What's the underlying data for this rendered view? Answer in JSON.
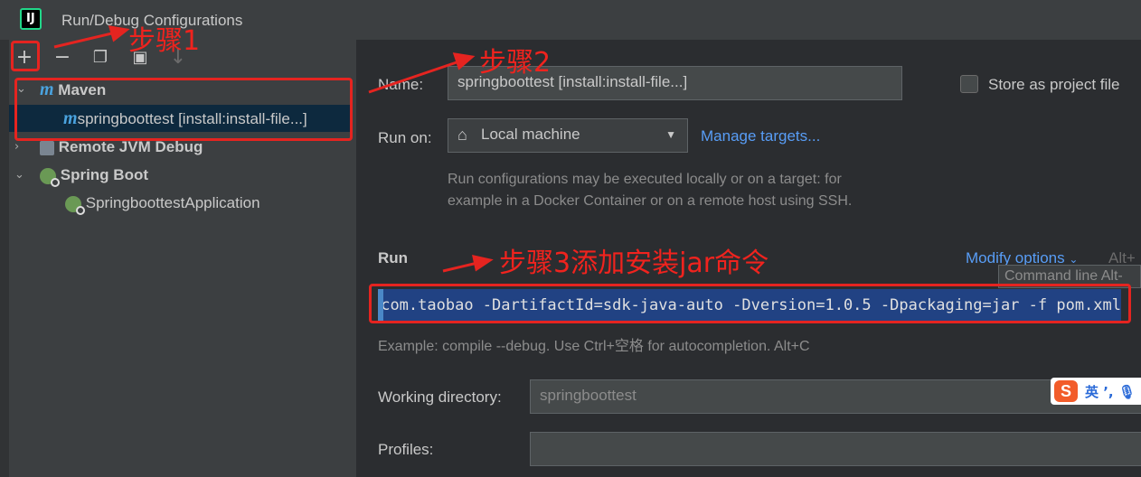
{
  "window": {
    "title": "Run/Debug Configurations",
    "app_icon_letter": "IJ"
  },
  "toolbar": {
    "add": "+",
    "remove": "−",
    "copy": "❐",
    "folder": "▣",
    "sort": "↓"
  },
  "tree": [
    {
      "label": "Maven",
      "expanded": true
    },
    {
      "label": "springboottest [install:install-file...]",
      "selected": true
    },
    {
      "label": "Remote JVM Debug",
      "expanded": false
    },
    {
      "label": "Spring Boot",
      "expanded": true
    },
    {
      "label": "SpringboottestApplication"
    }
  ],
  "form": {
    "name_label": "Name:",
    "name_value": "springboottest [install:install-file...]",
    "store_label": "Store as project file",
    "run_on_label": "Run on:",
    "run_on_value": "Local machine",
    "manage_targets": "Manage targets...",
    "run_on_hint_1": "Run configurations may be executed locally or on a target: for",
    "run_on_hint_2": "example in a Docker Container or on a remote host using SSH.",
    "run_section": "Run",
    "modify_options": "Modify options",
    "modify_shortcut": "Alt+",
    "tooltip": "Command line Alt-",
    "command": "-DgroupId=com.taobao -DartifactId=sdk-java-auto -Dversion=1.0.5 -Dpackaging=jar -f pom.xml",
    "command_hint": "Example: compile --debug. Use Ctrl+空格 for autocompletion. Alt+C",
    "working_dir_label": "Working directory:",
    "working_dir_value": "springboottest",
    "profiles_label": "Profiles:"
  },
  "annotations": {
    "step1": "步骤1",
    "step2": "步骤2",
    "step3": "步骤3添加安装jar命令",
    "color": "#e52420"
  },
  "ime": {
    "logo": "S",
    "text": "英 ’, 🎙"
  }
}
